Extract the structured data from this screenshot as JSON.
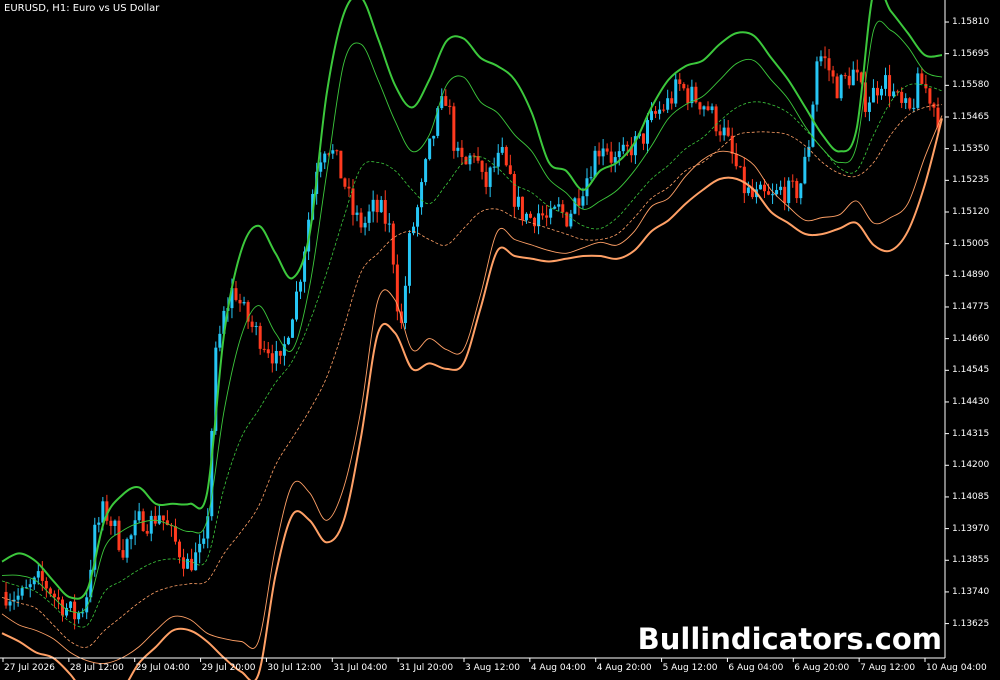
{
  "title": "EURUSD, H1:  Euro vs US Dollar",
  "watermark": "Bullindicators.com",
  "colors": {
    "background": "#000000",
    "axis": "#ffffff",
    "bull_candle": "#26c6f5",
    "bear_candle": "#ff3a1f",
    "upper_band": "#3cc83c",
    "lower_band": "#ffa066"
  },
  "chart_data": {
    "type": "candlestick",
    "symbol": "EURUSD",
    "timeframe": "H1",
    "ylim": [
      1.135,
      1.1589
    ],
    "y_ticks": [
      "1.15810",
      "1.15695",
      "1.15580",
      "1.15465",
      "1.15350",
      "1.15235",
      "1.15120",
      "1.15005",
      "1.14890",
      "1.14775",
      "1.14660",
      "1.14545",
      "1.14430",
      "1.14315",
      "1.14200",
      "1.14085",
      "1.13970",
      "1.13855",
      "1.13740",
      "1.13625"
    ],
    "x_ticks": [
      "27 Jul 2026",
      "28 Jul 12:00",
      "29 Jul 04:00",
      "29 Jul 20:00",
      "30 Jul 12:00",
      "31 Jul 04:00",
      "31 Jul 20:00",
      "3 Aug 12:00",
      "4 Aug 04:00",
      "4 Aug 20:00",
      "5 Aug 12:00",
      "6 Aug 04:00",
      "6 Aug 20:00",
      "7 Aug 12:00",
      "10 Aug 04:00"
    ],
    "close_path": [
      1.1374,
      1.1373,
      1.1372,
      1.1375,
      1.1378,
      1.1376,
      1.1371,
      1.1368,
      1.1365,
      1.137,
      1.1395,
      1.1404,
      1.1398,
      1.139,
      1.1394,
      1.1401,
      1.1399,
      1.1403,
      1.1396,
      1.139,
      1.1384,
      1.1387,
      1.139,
      1.1458,
      1.1475,
      1.1485,
      1.1476,
      1.147,
      1.1466,
      1.1462,
      1.1455,
      1.1472,
      1.1485,
      1.1508,
      1.153,
      1.1538,
      1.1531,
      1.1522,
      1.151,
      1.1507,
      1.1513,
      1.1512,
      1.1504,
      1.1467,
      1.1502,
      1.1515,
      1.1533,
      1.1546,
      1.1555,
      1.1532,
      1.1528,
      1.1535,
      1.152,
      1.1528,
      1.1532,
      1.152,
      1.1512,
      1.151,
      1.1512,
      1.1508,
      1.1513,
      1.151,
      1.1517,
      1.1524,
      1.1533,
      1.1538,
      1.153,
      1.1532,
      1.1536,
      1.1538,
      1.1545,
      1.1549,
      1.1552,
      1.1558,
      1.1555,
      1.1553,
      1.1551,
      1.1545,
      1.154,
      1.153,
      1.1521,
      1.1517,
      1.1518,
      1.1516,
      1.152,
      1.1519,
      1.152,
      1.1535,
      1.157,
      1.1566,
      1.1557,
      1.156,
      1.1563,
      1.1552,
      1.1555,
      1.1561,
      1.1556,
      1.155,
      1.1548,
      1.156,
      1.1555,
      1.1547
    ],
    "series": [
      {
        "name": "upper",
        "values": [
          1.1385,
          1.1388,
          1.1385,
          1.1378,
          1.1372,
          1.1375,
          1.14,
          1.1409,
          1.1412,
          1.1406,
          1.1406,
          1.1406,
          1.141,
          1.1468,
          1.1498,
          1.1507,
          1.1497,
          1.1488,
          1.1504,
          1.1555,
          1.1584,
          1.159,
          1.1575,
          1.1558,
          1.155,
          1.156,
          1.1574,
          1.1575,
          1.1568,
          1.1565,
          1.156,
          1.1548,
          1.153,
          1.1527,
          1.152,
          1.1527,
          1.153,
          1.1537,
          1.155,
          1.156,
          1.1565,
          1.1567,
          1.1573,
          1.1577,
          1.1576,
          1.1568,
          1.156,
          1.155,
          1.154,
          1.1534,
          1.1542,
          1.1592,
          1.1585,
          1.1577,
          1.1569,
          1.1569
        ]
      },
      {
        "name": "upper_inner",
        "values": [
          1.138,
          1.138,
          1.1378,
          1.1372,
          1.1367,
          1.1369,
          1.139,
          1.1396,
          1.1399,
          1.14,
          1.1398,
          1.1396,
          1.14,
          1.144,
          1.1467,
          1.1478,
          1.1468,
          1.1462,
          1.1485,
          1.1526,
          1.1566,
          1.1573,
          1.156,
          1.1545,
          1.1534,
          1.154,
          1.1558,
          1.1561,
          1.1552,
          1.1548,
          1.154,
          1.1534,
          1.1524,
          1.1519,
          1.1513,
          1.1516,
          1.152,
          1.1527,
          1.1536,
          1.1546,
          1.1551,
          1.1554,
          1.156,
          1.1566,
          1.1567,
          1.156,
          1.1553,
          1.1543,
          1.1535,
          1.153,
          1.1536,
          1.1578,
          1.1578,
          1.1572,
          1.1563,
          1.1561
        ]
      },
      {
        "name": "middle_dashed",
        "values": [
          1.1378,
          1.1376,
          1.1374,
          1.1369,
          1.1363,
          1.1362,
          1.1374,
          1.1378,
          1.1382,
          1.1385,
          1.1386,
          1.1385,
          1.1386,
          1.1412,
          1.143,
          1.144,
          1.145,
          1.1458,
          1.1472,
          1.149,
          1.151,
          1.1528,
          1.153,
          1.1527,
          1.152,
          1.1515,
          1.1522,
          1.153,
          1.1532,
          1.1528,
          1.1522,
          1.1519,
          1.1514,
          1.1511,
          1.1507,
          1.1506,
          1.151,
          1.1517,
          1.1524,
          1.1529,
          1.1535,
          1.1539,
          1.1545,
          1.155,
          1.1552,
          1.1551,
          1.1548,
          1.1542,
          1.1535,
          1.1528,
          1.1527,
          1.154,
          1.1552,
          1.1558,
          1.1558,
          1.1556
        ]
      },
      {
        "name": "middle_light",
        "values": [
          1.1372,
          1.137,
          1.1368,
          1.1362,
          1.1356,
          1.1354,
          1.136,
          1.1365,
          1.137,
          1.1374,
          1.1376,
          1.1377,
          1.1378,
          1.1388,
          1.1396,
          1.1405,
          1.142,
          1.143,
          1.144,
          1.1452,
          1.147,
          1.149,
          1.1497,
          1.1503,
          1.1505,
          1.1502,
          1.15,
          1.1506,
          1.1512,
          1.1513,
          1.151,
          1.1508,
          1.1506,
          1.1504,
          1.1502,
          1.1502,
          1.1504,
          1.151,
          1.1517,
          1.1521,
          1.1527,
          1.153,
          1.1535,
          1.154,
          1.1541,
          1.1541,
          1.154,
          1.1536,
          1.153,
          1.1526,
          1.1525,
          1.153,
          1.154,
          1.1547,
          1.155,
          1.1551
        ]
      },
      {
        "name": "lower_inner",
        "values": [
          1.1366,
          1.1362,
          1.136,
          1.1357,
          1.1352,
          1.1349,
          1.1348,
          1.135,
          1.1354,
          1.136,
          1.1365,
          1.1364,
          1.1359,
          1.1357,
          1.1356,
          1.1356,
          1.139,
          1.1413,
          1.141,
          1.14,
          1.1412,
          1.144,
          1.148,
          1.148,
          1.1462,
          1.1466,
          1.1462,
          1.1462,
          1.1482,
          1.1505,
          1.1502,
          1.15,
          1.1498,
          1.1497,
          1.1499,
          1.1501,
          1.15,
          1.1505,
          1.1514,
          1.1517,
          1.1525,
          1.1531,
          1.1534,
          1.1533,
          1.1529,
          1.152,
          1.1514,
          1.1509,
          1.151,
          1.1511,
          1.1516,
          1.1508,
          1.151,
          1.1515,
          1.1532,
          1.1547
        ]
      },
      {
        "name": "lower",
        "values": [
          1.1359,
          1.1356,
          1.1352,
          1.135,
          1.1344,
          1.1336,
          1.1334,
          1.1338,
          1.1348,
          1.1354,
          1.136,
          1.136,
          1.1356,
          1.135,
          1.1345,
          1.1344,
          1.138,
          1.1402,
          1.14,
          1.1392,
          1.14,
          1.143,
          1.1468,
          1.1468,
          1.1455,
          1.1457,
          1.1455,
          1.1457,
          1.1477,
          1.1498,
          1.1496,
          1.1495,
          1.1494,
          1.1495,
          1.1496,
          1.1496,
          1.1495,
          1.1498,
          1.1505,
          1.1509,
          1.1515,
          1.152,
          1.1524,
          1.1524,
          1.152,
          1.1512,
          1.1508,
          1.1504,
          1.1504,
          1.1506,
          1.1508,
          1.15,
          1.1498,
          1.1505,
          1.1522,
          1.1546
        ]
      }
    ]
  }
}
